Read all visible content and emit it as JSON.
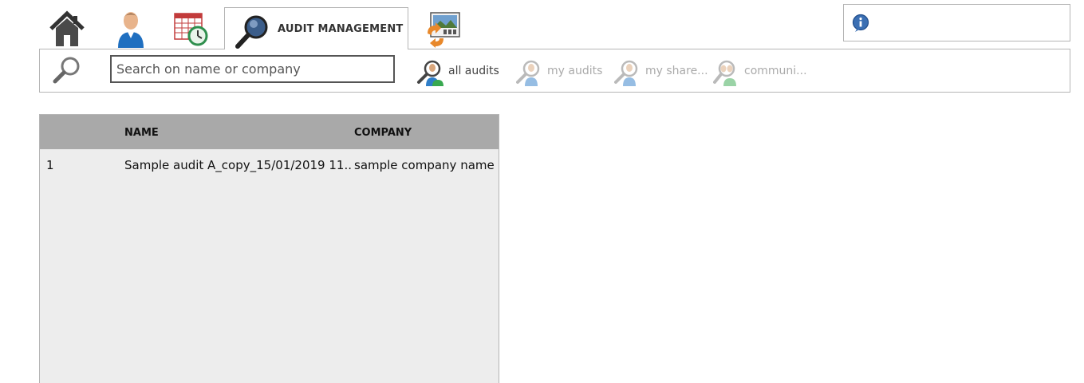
{
  "nav": {
    "icons": [
      "home-icon",
      "user-icon",
      "calendar-clock-icon",
      "search-icon",
      "report-refresh-icon"
    ],
    "active_tab_label": "AUDIT MANAGEMENT",
    "info_icon": "info-icon"
  },
  "toolbar": {
    "search_placeholder": "Search on name or company",
    "search_value": "",
    "filters": [
      {
        "label": "all audits",
        "state": "active",
        "icon": "all-audits-icon"
      },
      {
        "label": "my audits",
        "state": "disabled",
        "icon": "my-audits-icon"
      },
      {
        "label": "my share...",
        "state": "disabled",
        "icon": "my-shared-icon"
      },
      {
        "label": "communi...",
        "state": "disabled",
        "icon": "community-icon"
      }
    ]
  },
  "grid": {
    "columns": [
      "",
      "NAME",
      "COMPANY"
    ],
    "rows": [
      {
        "index": "1",
        "name": "Sample audit A_copy_15/01/2019 11...",
        "company": "sample company name"
      }
    ]
  },
  "colors": {
    "header_bg": "#a9a9a9",
    "grid_bg": "#ededed",
    "border": "#b5b5b5",
    "disabled_text": "#aaaaaa"
  }
}
